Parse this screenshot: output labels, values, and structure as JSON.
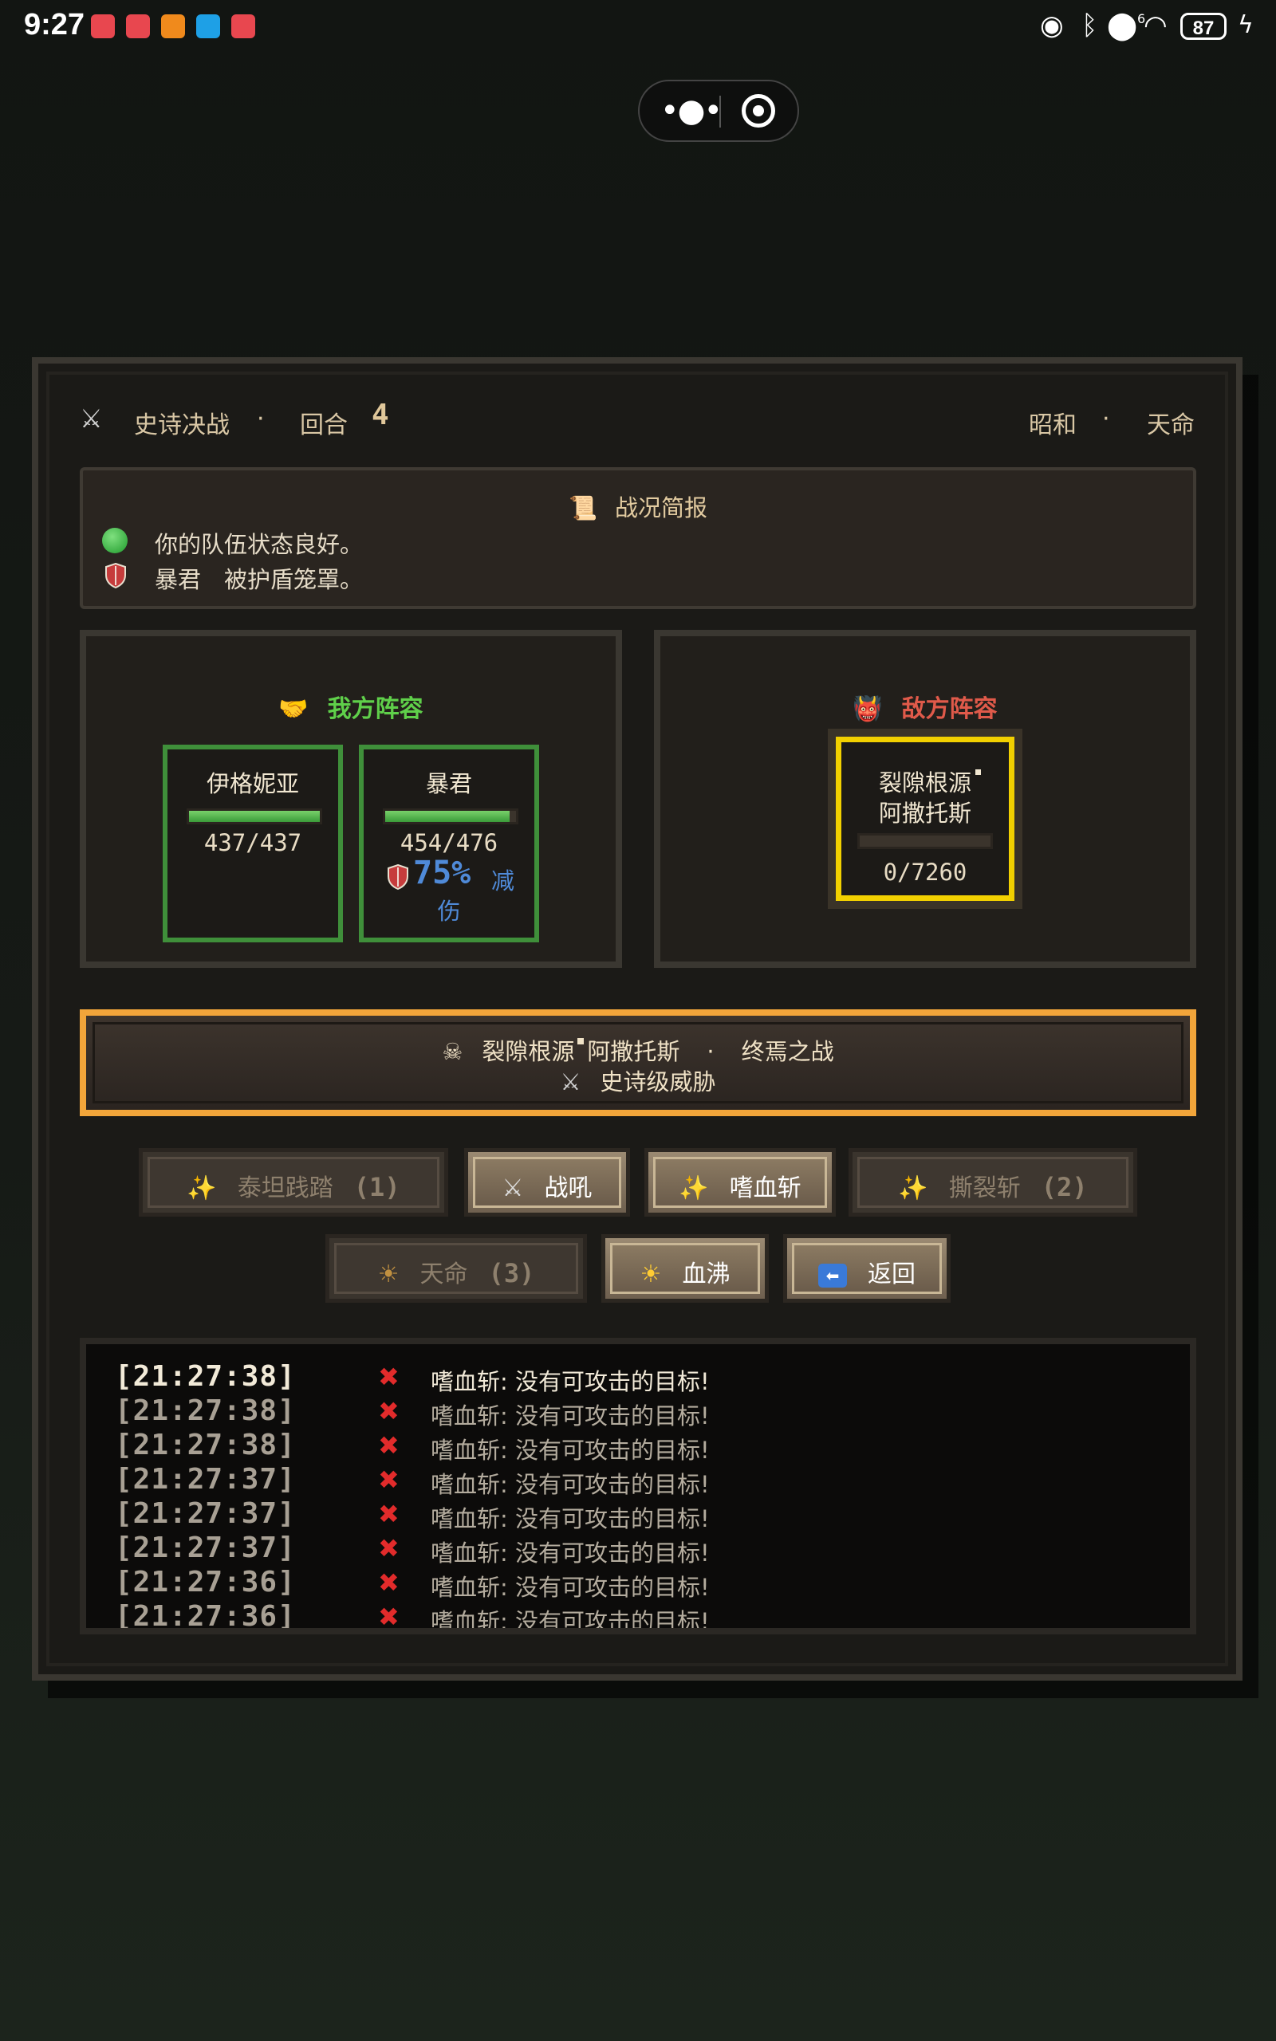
{
  "status_bar": {
    "time": "9:27",
    "battery": "87",
    "signal": "6"
  },
  "header": {
    "title": "史诗决战",
    "separator": "·",
    "round_label": "回合",
    "round_number": "4",
    "right_left": "昭和",
    "right_sep": "·",
    "right_right": "天命"
  },
  "briefing": {
    "title": "战况简报",
    "lines": [
      "你的队伍状态良好。",
      "暴君　被护盾笼罩。"
    ]
  },
  "ally_team": {
    "title": "我方阵容",
    "units": [
      {
        "name": "伊格妮亚",
        "hp": "437/437",
        "hp_ratio": 1.0
      },
      {
        "name": "暴君",
        "hp": "454/476",
        "hp_ratio": 0.954,
        "shield_value": "75%",
        "shield_text_1": "减",
        "shield_text_2": "伤"
      }
    ]
  },
  "enemy_team": {
    "title": "敌方阵容",
    "units": [
      {
        "name_line1": "裂隙根源",
        "name_line2": "阿撒托斯",
        "hp": "0/7260",
        "hp_ratio": 0.0
      }
    ]
  },
  "boss_banner": {
    "name": "裂隙根源",
    "name2": "阿撒托斯",
    "sep": "·",
    "battle": "终焉之战",
    "threat": "史诗级威胁"
  },
  "skills": [
    {
      "label": "泰坦践踏",
      "cooldown": "(1)",
      "disabled": true,
      "icon": "sparkle-icon"
    },
    {
      "label": "战吼",
      "cooldown": "",
      "disabled": false,
      "icon": "crossed-swords-icon"
    },
    {
      "label": "嗜血斩",
      "cooldown": "",
      "disabled": false,
      "icon": "sparkle-icon"
    },
    {
      "label": "撕裂斩",
      "cooldown": "(2)",
      "disabled": true,
      "icon": "sparkle-icon"
    },
    {
      "label": "天命",
      "cooldown": "(3)",
      "disabled": true,
      "icon": "sun-icon"
    },
    {
      "label": "血沸",
      "cooldown": "",
      "disabled": false,
      "icon": "sun-icon"
    },
    {
      "label": "返回",
      "cooldown": "",
      "disabled": false,
      "icon": "back-icon"
    }
  ],
  "log": [
    {
      "time": "[21:27:38]",
      "msg": "嗜血斩: 没有可攻击的目标!"
    },
    {
      "time": "[21:27:38]",
      "msg": "嗜血斩: 没有可攻击的目标!"
    },
    {
      "time": "[21:27:38]",
      "msg": "嗜血斩: 没有可攻击的目标!"
    },
    {
      "time": "[21:27:37]",
      "msg": "嗜血斩: 没有可攻击的目标!"
    },
    {
      "time": "[21:27:37]",
      "msg": "嗜血斩: 没有可攻击的目标!"
    },
    {
      "time": "[21:27:37]",
      "msg": "嗜血斩: 没有可攻击的目标!"
    },
    {
      "time": "[21:27:36]",
      "msg": "嗜血斩: 没有可攻击的目标!"
    },
    {
      "time": "[21:27:36]",
      "msg": "嗜血斩: 没有可攻击的目标!"
    }
  ],
  "colors": {
    "ally_title": "#5fcf4a",
    "enemy_title": "#e05a4a",
    "ally_frame": "#3f8f3a",
    "enemy_frame": "#f2d000",
    "banner_border": "#f2a53a",
    "shield_text": "#4f8ad8"
  }
}
